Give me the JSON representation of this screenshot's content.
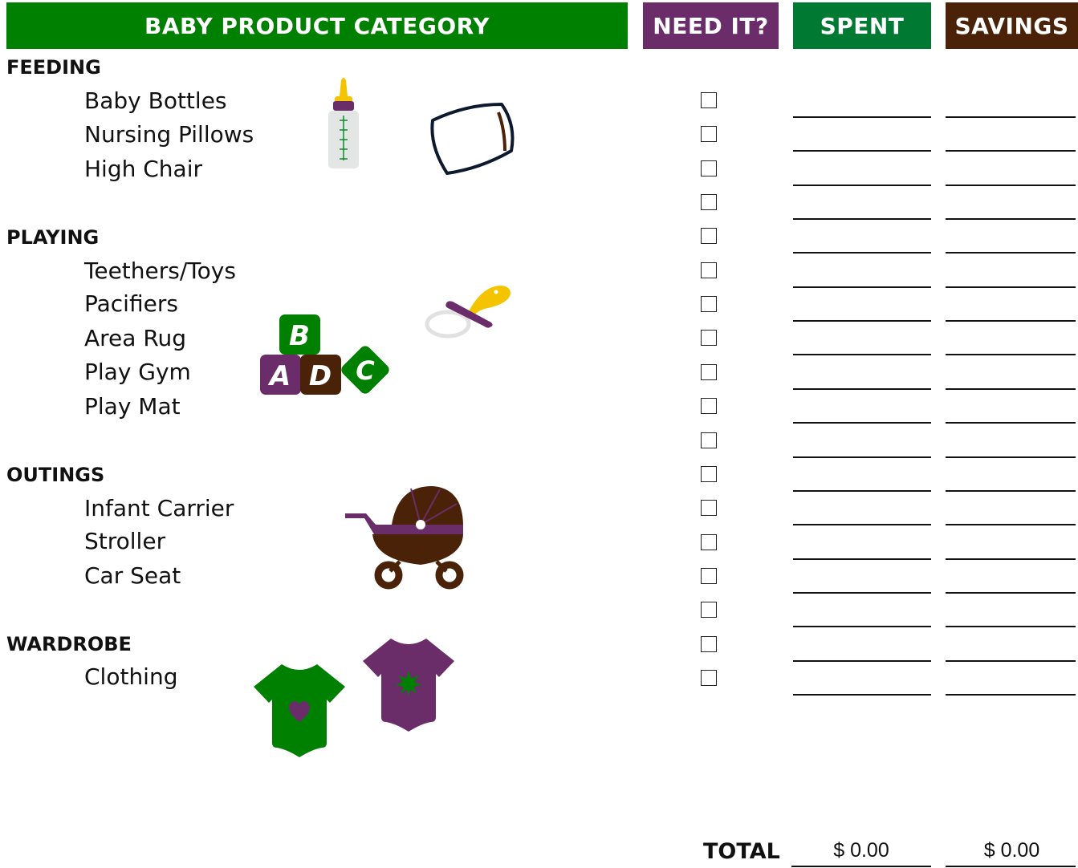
{
  "header": {
    "category": "BABY PRODUCT CATEGORY",
    "need_it": "NEED IT?",
    "spent": "SPENT",
    "savings": "SAVINGS"
  },
  "colors": {
    "green": "#008000",
    "purple": "#6b2d69",
    "dark_green": "#007a33",
    "brown": "#4a2208"
  },
  "sections": {
    "feeding": {
      "title": "FEEDING",
      "items": [
        "Baby Bottles",
        "Nursing Pillows",
        "High Chair"
      ]
    },
    "playing": {
      "title": "PLAYING",
      "items": [
        "Teethers/Toys",
        "Pacifiers",
        "Area Rug",
        "Play Gym",
        "Play Mat"
      ]
    },
    "outings": {
      "title": "OUTINGS",
      "items": [
        "Infant Carrier",
        "Stroller",
        "Car Seat"
      ]
    },
    "wardrobe": {
      "title": "WARDROBE",
      "items": [
        "Clothing"
      ]
    }
  },
  "icons": {
    "bottle": "baby-bottle-icon",
    "pillow": "pillow-icon",
    "blocks": "abc-blocks-icon",
    "pacifier": "pacifier-icon",
    "stroller": "stroller-icon",
    "onesie_green": "onesie-heart-icon",
    "onesie_purple": "onesie-star-icon"
  },
  "blocks": {
    "a": "A",
    "b": "B",
    "c": "C",
    "d": "D"
  },
  "checkbox_count": 18,
  "total": {
    "label": "TOTAL",
    "spent": "$ 0.00",
    "savings": "$ 0.00"
  }
}
